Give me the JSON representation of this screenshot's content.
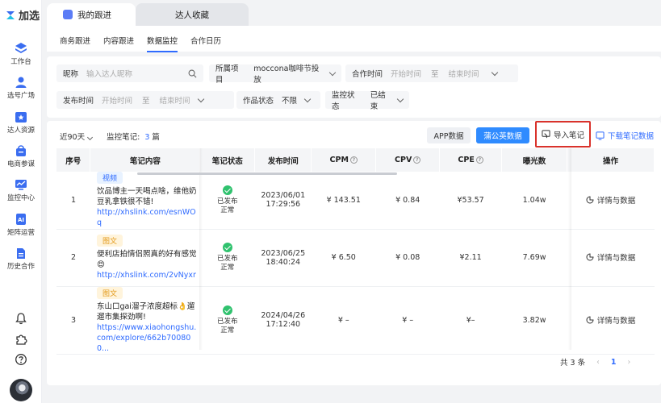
{
  "app": {
    "logo_text": "加选"
  },
  "sidebar": {
    "items": [
      {
        "label": "工作台",
        "icon": "layers-icon"
      },
      {
        "label": "选号广场",
        "icon": "user-icon"
      },
      {
        "label": "达人资源",
        "icon": "star-folder-icon"
      },
      {
        "label": "电商参谋",
        "icon": "shopping-bag-icon"
      },
      {
        "label": "监控中心",
        "icon": "monitor-icon"
      },
      {
        "label": "矩阵运营",
        "icon": "ai-matrix-icon"
      },
      {
        "label": "历史合作",
        "icon": "history-icon"
      }
    ]
  },
  "top_tabs": [
    {
      "label": "我的跟进"
    },
    {
      "label": "达人收藏"
    }
  ],
  "sub_tabs": [
    {
      "label": "商务跟进"
    },
    {
      "label": "内容跟进"
    },
    {
      "label": "数据监控"
    },
    {
      "label": "合作日历"
    }
  ],
  "filters": {
    "nickname": {
      "label": "昵称",
      "placeholder": "输入达人昵称"
    },
    "project": {
      "label": "所属项目",
      "value": "moccona咖啡节投放"
    },
    "coop_time": {
      "label": "合作时间",
      "start": "开始时间",
      "sep": "至",
      "end": "结束时间"
    },
    "publish_time": {
      "label": "发布时间",
      "start": "开始时间",
      "sep": "至",
      "end": "结束时间"
    },
    "work_status": {
      "label": "作品状态",
      "value": "不限"
    },
    "monitor_status": {
      "label": "监控状态",
      "value": "已结束"
    }
  },
  "toolbar": {
    "range": "近90天",
    "notes_label": "监控笔记:",
    "notes_count": "3",
    "notes_unit": "篇",
    "app_data": "APP数据",
    "pgy_data": "蒲公英数据",
    "import_notes": "导入笔记",
    "download_data": "下载笔记数据"
  },
  "table": {
    "headers": [
      "序号",
      "笔记内容",
      "笔记状态",
      "发布时间",
      "CPM",
      "CPV",
      "CPE",
      "曝光数",
      "操作"
    ],
    "rows": [
      {
        "idx": "1",
        "tag": "视频",
        "title": "饮品博主一天喝点啥，维他奶豆乳拿铁很不错!",
        "link": "http://xhslink.com/esnWOq",
        "status1": "已发布",
        "status2": "正常",
        "date": "2023/06/01",
        "time": "17:29:56",
        "cpm": "¥ 143.51",
        "cpv": "¥ 0.84",
        "cpe": "¥53.57",
        "exposure": "1.04w",
        "action": "详情与数据"
      },
      {
        "idx": "2",
        "tag": "图文",
        "title": "便利店拍情侣照真的好有感觉😍",
        "link": "http://xhslink.com/2vNyxr",
        "status1": "已发布",
        "status2": "正常",
        "date": "2023/06/25",
        "time": "18:40:24",
        "cpm": "¥ 6.50",
        "cpv": "¥ 0.08",
        "cpe": "¥2.11",
        "exposure": "7.69w",
        "action": "详情与数据"
      },
      {
        "idx": "3",
        "tag": "图文",
        "title": "东山口gai溜子浓度超标👌遛遛市集探劲啊!",
        "link": "https://www.xiaohongshu.com/explore/662b700800...",
        "status1": "已发布",
        "status2": "正常",
        "date": "2024/04/26",
        "time": "17:12:40",
        "cpm": "¥ –",
        "cpv": "¥ –",
        "cpe": "¥–",
        "exposure": "3.82w",
        "action": "详情与数据"
      }
    ]
  },
  "pagination": {
    "total": "共 3 条",
    "prev": "‹",
    "page": "1",
    "next": "›"
  },
  "colors": {
    "primary": "#2f6bff",
    "button_blue": "#2f8bff",
    "highlight_red": "#d9322b",
    "success": "#30c26e"
  }
}
